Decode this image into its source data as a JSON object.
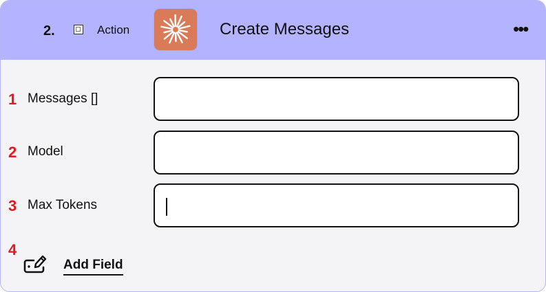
{
  "header": {
    "step_number": "2.",
    "step_type": "Action",
    "title": "Create Messages",
    "app_icon": "starburst-logo-icon",
    "more_icon": "more-horizontal-icon"
  },
  "fields": [
    {
      "marker": "1",
      "label": "Messages []",
      "value": ""
    },
    {
      "marker": "2",
      "label": "Model",
      "value": ""
    },
    {
      "marker": "3",
      "label": "Max Tokens",
      "value": ""
    }
  ],
  "add_field": {
    "marker": "4",
    "label": "Add Field",
    "icon": "edit-field-icon"
  },
  "colors": {
    "header_bg": "#b3b3ff",
    "card_bg": "#f4f4f7",
    "app_icon_bg": "#d97a59",
    "marker": "#e8161e"
  }
}
